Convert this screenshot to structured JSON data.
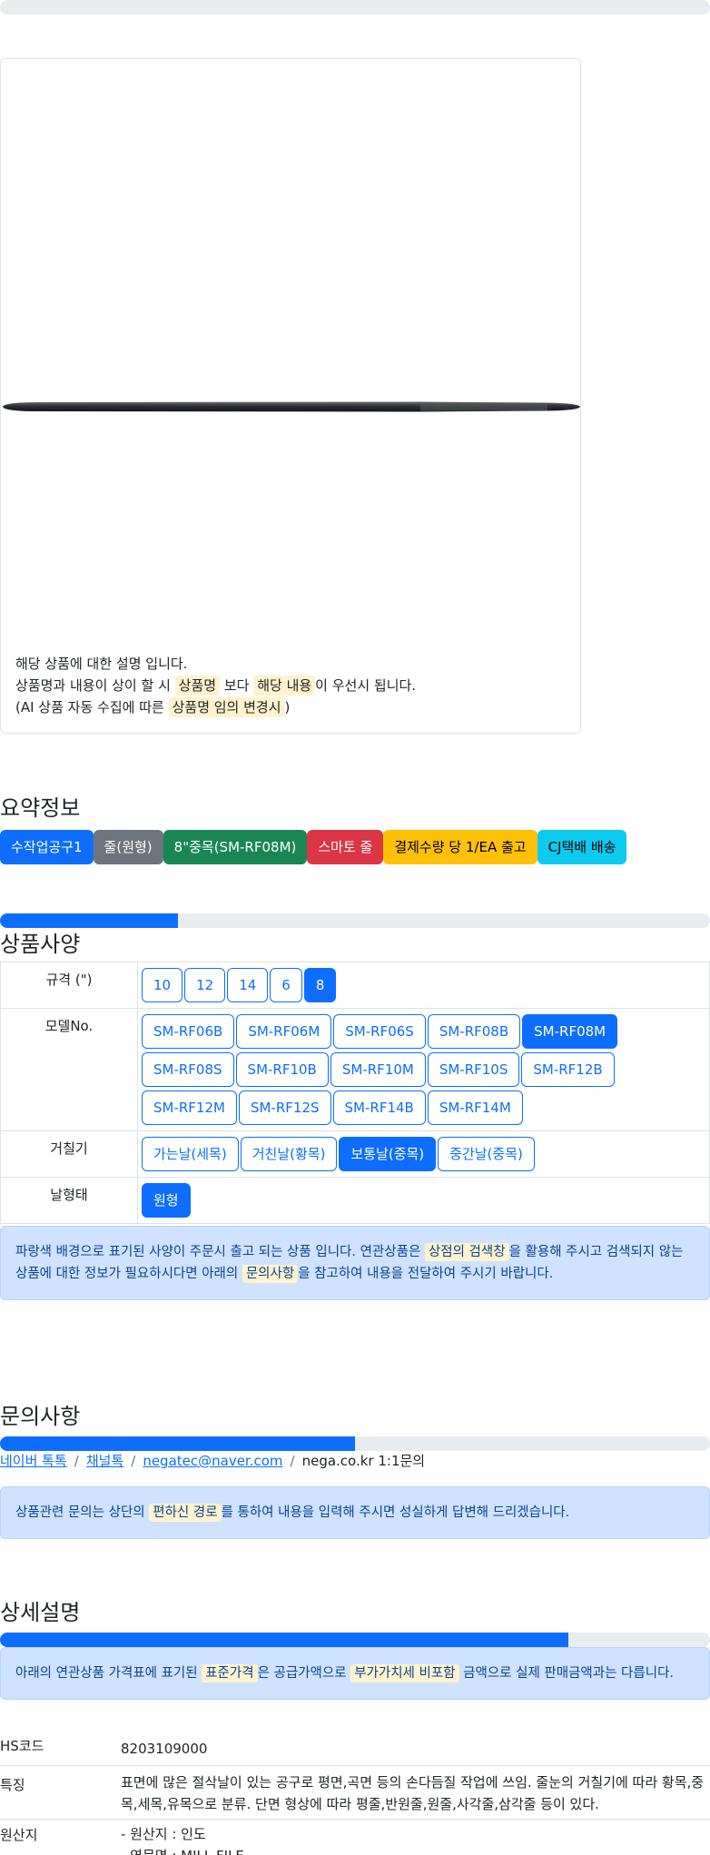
{
  "card": {
    "note_line1": "해당 상품에 대한 설명 입니다.",
    "note_line2_a": "상품명과 내용이 상이 할 시 ",
    "note_line2_hl1": "상품명",
    "note_line2_b": " 보다 ",
    "note_line2_hl2": "해당 내용",
    "note_line2_c": "이 우선시 됩니다.",
    "note_line3_a": "(AI 상품 자동 수집에 따른 ",
    "note_line3_hl": "상품명 임의 변경시",
    "note_line3_b": ")"
  },
  "summary": {
    "title": "요약정보",
    "badges": [
      "수작업공구1",
      "줄(원형)",
      "8\"중목(SM-RF08M)",
      "스마토 줄",
      "결제수량 당 1/EA 출고",
      "CJ택배 배송"
    ]
  },
  "spec": {
    "title": "상품사양",
    "progress": 0.25,
    "rows": [
      {
        "label": "규격 (\")",
        "options": [
          "10",
          "12",
          "14",
          "6",
          "8"
        ],
        "selected": "8"
      },
      {
        "label": "모델No.",
        "options": [
          "SM-RF06B",
          "SM-RF06M",
          "SM-RF06S",
          "SM-RF08B",
          "SM-RF08M",
          "SM-RF08S",
          "SM-RF10B",
          "SM-RF10M",
          "SM-RF10S",
          "SM-RF12B",
          "SM-RF12M",
          "SM-RF12S",
          "SM-RF14B",
          "SM-RF14M"
        ],
        "selected": "SM-RF08M"
      },
      {
        "label": "거칠기",
        "options": [
          "가는날(세목)",
          "거친날(황목)",
          "보통날(중목)",
          "중간날(중목)"
        ],
        "selected": "보통날(중목)"
      },
      {
        "label": "날형태",
        "options": [
          "원형"
        ],
        "selected": "원형"
      }
    ],
    "alert_a": "파랑색 배경으로 표기된 사양이 주문시 출고 되는 상품 입니다. 연관상품은 ",
    "alert_hl1": "상점의 검색창",
    "alert_b": "을 활용해 주시고 검색되지 않는 상품에 대한 정보가 필요하시다면 아래의 ",
    "alert_hl2": "문의사항",
    "alert_c": "을 참고하여 내용을 전달하여 주시기 바랍니다."
  },
  "inquiry": {
    "title": "문의사항",
    "progress": 0.5,
    "links": [
      "네이버 톡톡",
      "채널톡",
      "negatec@naver.com"
    ],
    "plain": "nega.co.kr 1:1문의",
    "separator": "/",
    "alert_a": "상품관련 문의는 상단의 ",
    "alert_hl": "편하신 경로",
    "alert_b": "를 통하여 내용을 입력해 주시면 성실하게 답변해 드리겠습니다."
  },
  "detail": {
    "title": "상세설명",
    "progress": 0.8,
    "alert_a": "아래의 연관상품 가격표에 표기된 ",
    "alert_hl1": "표준가격",
    "alert_b": "은 공급가액으로 ",
    "alert_hl2": "부가가치세 비포함",
    "alert_c": " 금액으로 실제 판매금액과는 다릅니다.",
    "hs_label": "HS코드",
    "hs_value": "8203109000",
    "feature_label": "특징",
    "feature_value": "표면에 많은 절삭날이 있는 공구로 평면,곡면 등의 손다듬질 작업에 쓰임. 줄눈의 거칠기에 따라 황목,중목,세목,유목으로 분류. 단면 형상에 따라 평줄,반원줄,원줄,사각줄,삼각줄 등이 있다.",
    "origin_label": "원산지",
    "origin_line1": "- 원산지 : 인도",
    "origin_line2": "- 영문명 : MILL FILE"
  }
}
